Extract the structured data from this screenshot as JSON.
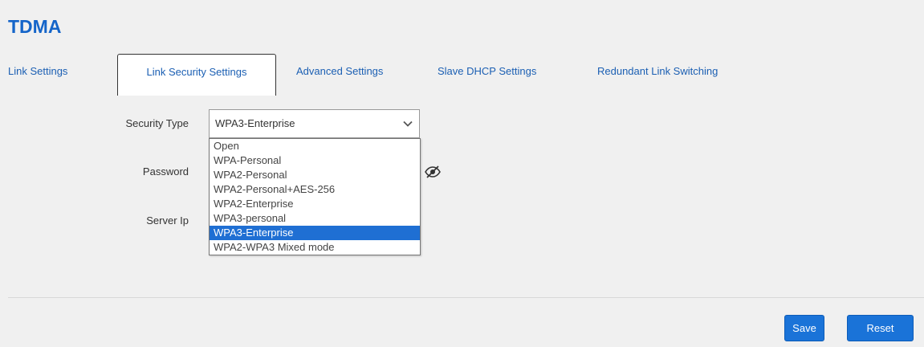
{
  "page": {
    "title": "TDMA"
  },
  "tabs": [
    {
      "label": "Link Settings"
    },
    {
      "label": "Link Security Settings"
    },
    {
      "label": "Advanced Settings"
    },
    {
      "label": "Slave DHCP Settings"
    },
    {
      "label": "Redundant Link Switching"
    }
  ],
  "form": {
    "security_type_label": "Security Type",
    "password_label": "Password",
    "server_ip_label": "Server Ip",
    "security_type_value": "WPA3-Enterprise",
    "options": [
      "Open",
      "WPA-Personal",
      "WPA2-Personal",
      "WPA2-Personal+AES-256",
      "WPA2-Enterprise",
      "WPA3-personal",
      "WPA3-Enterprise",
      "WPA2-WPA3 Mixed mode"
    ]
  },
  "actions": {
    "save_label": "Save",
    "reset_label": "Reset"
  },
  "icons": {
    "password_toggle": "eye-slash-icon",
    "select_caret": "chevron-down-icon"
  },
  "colors": {
    "accent": "#1565c9",
    "selected_option": "#1f6fd3",
    "button": "#1a73d8"
  }
}
